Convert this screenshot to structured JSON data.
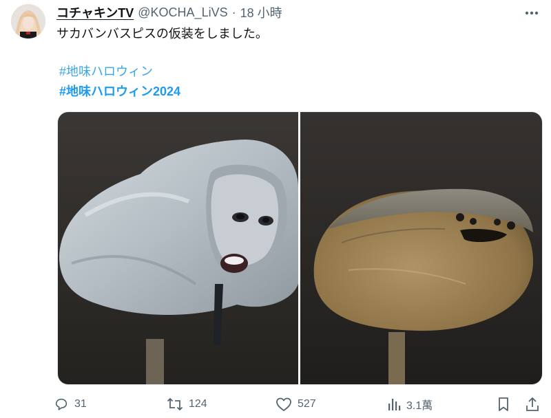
{
  "author": {
    "display_name": "コチャキンTV",
    "handle": "@KOCHA_LiVS",
    "separator": "·",
    "time": "18 小時"
  },
  "post": {
    "text": "サカバンバスピスの仮装をしました。",
    "hashtags": [
      "#地味ハロウィン",
      "#地味ハロウィン2024"
    ]
  },
  "icons": {
    "more": "more-options-icon",
    "reply": "reply-icon",
    "retweet": "retweet-icon",
    "like": "like-icon",
    "views": "views-icon",
    "bookmark": "bookmark-icon",
    "share": "share-icon"
  },
  "actions": {
    "replies": "31",
    "retweets": "124",
    "likes": "527",
    "views": "3.1萬"
  },
  "colors": {
    "link": "#1d9bf0",
    "secondary_text": "#536471",
    "primary_text": "#0f1419"
  }
}
